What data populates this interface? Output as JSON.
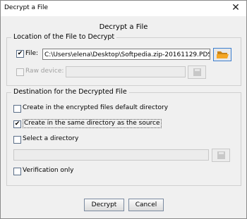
{
  "window": {
    "title": "Decrypt a File",
    "close_glyph": "✕"
  },
  "heading": "Decrypt a File",
  "location_group": {
    "legend": "Location of the File to Decrypt",
    "file": {
      "checked": true,
      "label": "File:",
      "value": "C:\\Users\\elena\\Desktop\\Softpedia.zip-20161129.PDS",
      "browse_icon": "folder-open-icon",
      "enabled": true
    },
    "raw_device": {
      "checked": false,
      "label": "Raw device:",
      "value": "",
      "browse_icon": "save-icon",
      "enabled": false
    }
  },
  "destination_group": {
    "legend": "Destination for the Decrypted File",
    "options": [
      {
        "label": "Create in the encrypted files default directory",
        "checked": false
      },
      {
        "label": "Create in the same directory as the source",
        "checked": true
      },
      {
        "label": "Select a directory",
        "checked": false
      }
    ],
    "directory": {
      "value": "",
      "enabled": false,
      "browse_icon": "save-icon"
    },
    "verification": {
      "label": "Verification only",
      "checked": false
    }
  },
  "buttons": {
    "decrypt": "Decrypt",
    "cancel": "Cancel"
  },
  "colors": {
    "folder_accent": "#f5a623",
    "focus_border": "#3c7fd0"
  }
}
